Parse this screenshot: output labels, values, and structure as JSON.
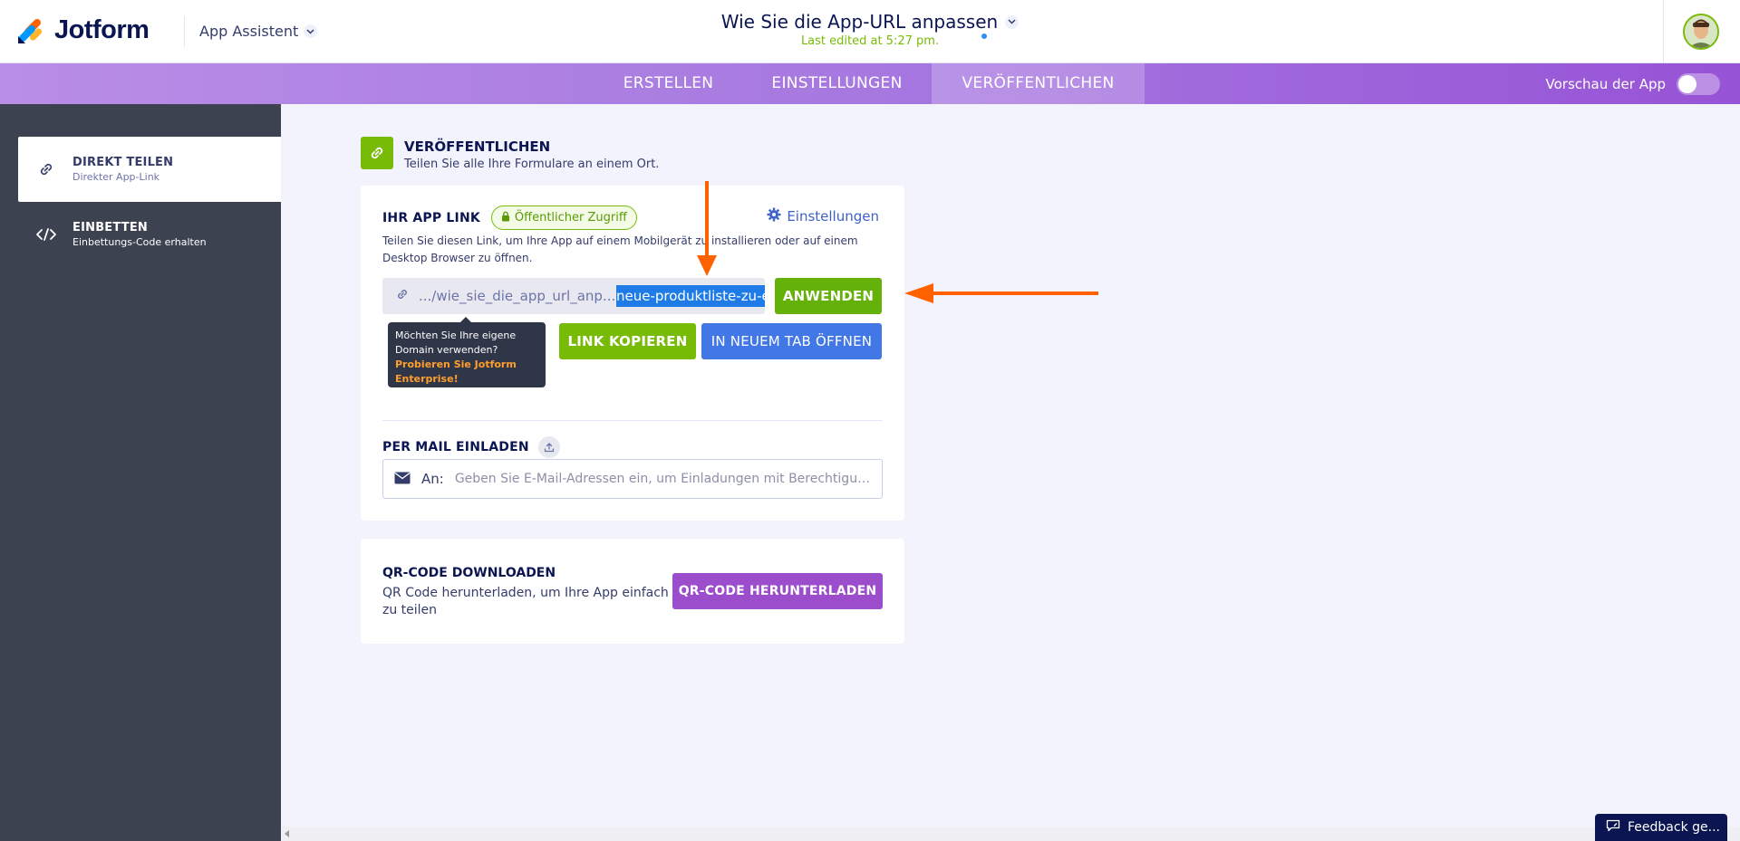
{
  "header": {
    "brand": "Jotform",
    "app_assistant": "App Assistent",
    "doc_title": "Wie Sie die App-URL anpassen",
    "last_edited": "Last edited at 5:27 pm."
  },
  "nav": {
    "tabs": [
      {
        "label": "ERSTELLEN"
      },
      {
        "label": "EINSTELLUNGEN"
      },
      {
        "label": "VERÖFFENTLICHEN"
      }
    ],
    "active_tab": "VERÖFFENTLICHEN",
    "preview_label": "Vorschau der App",
    "preview_enabled": false
  },
  "sidebar": {
    "items": [
      {
        "title": "DIREKT TEILEN",
        "subtitle": "Direkter App-Link"
      },
      {
        "title": "EINBETTEN",
        "subtitle": "Einbettungs-Code erhalten"
      }
    ]
  },
  "section": {
    "title": "VERÖFFENTLICHEN",
    "subtitle": "Teilen Sie alle Ihre Formulare an einem Ort."
  },
  "app_link": {
    "label": "IHR APP LINK",
    "badge": "Öffentlicher Zugriff",
    "settings_label": "Einstellungen",
    "description": "Teilen Sie diesen Link, um Ihre App auf einem Mobilgerät zu installieren oder auf einem Desktop Browser zu öffnen.",
    "url_prefix": ".../wie_sie_die_app_url_anp...",
    "url_selected": "neue-produktliste-zu-e",
    "apply_label": "ANWENDEN",
    "copy_label": "LINK KOPIEREN",
    "open_label": "IN NEUEM TAB ÖFFNEN"
  },
  "tooltip": {
    "line1": "Möchten Sie Ihre eigene Domain verwenden?",
    "cta": "Probieren Sie Jotform Enterprise!"
  },
  "mail": {
    "label": "PER MAIL EINLADEN",
    "to_label": "An:",
    "placeholder": "Geben Sie E-Mail-Adressen ein, um Einladungen mit Berechtigungen zu..."
  },
  "qr": {
    "title": "QR-CODE DOWNLOADEN",
    "description": "QR Code herunterladen, um Ihre App einfach zu teilen",
    "button_label": "QR-CODE HERUNTERLADEN"
  },
  "feedback": {
    "label": "Feedback ge..."
  },
  "colors": {
    "brand_green": "#78bb07",
    "brand_purple": "#9c4dcc",
    "brand_blue": "#4277e6",
    "annotation_orange": "#ff6100",
    "sidebar_bg": "#3c4250"
  }
}
